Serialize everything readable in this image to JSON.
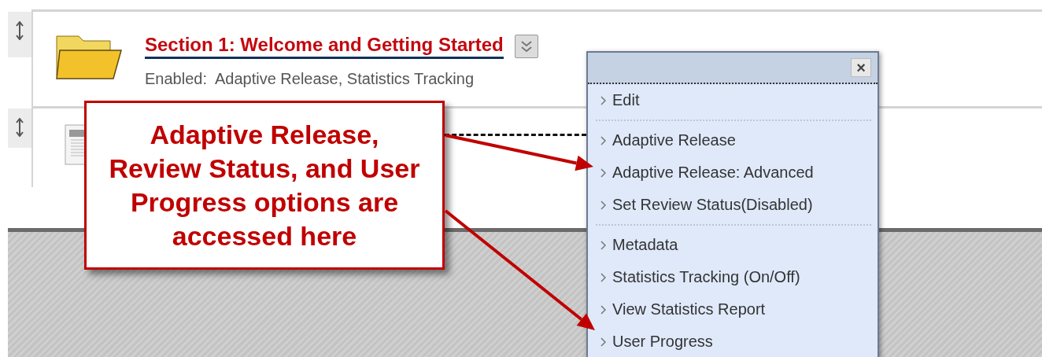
{
  "content_items": [
    {
      "kind": "folder",
      "title": "Section 1: Welcome and Getting Started",
      "enabled_text": "Enabled:  Adaptive Release, Statistics Tracking",
      "menu_open": true
    },
    {
      "kind": "document"
    }
  ],
  "context_menu": {
    "close_label": "×",
    "groups": [
      [
        "Edit"
      ],
      [
        "Adaptive Release",
        "Adaptive Release: Advanced",
        "Set Review Status(Disabled)"
      ],
      [
        "Metadata",
        "Statistics Tracking (On/Off)",
        "View Statistics Report",
        "User Progress"
      ]
    ]
  },
  "callout": {
    "lines": [
      "Adaptive Release,",
      "Review Status, and User",
      "Progress options are",
      "accessed here"
    ]
  }
}
